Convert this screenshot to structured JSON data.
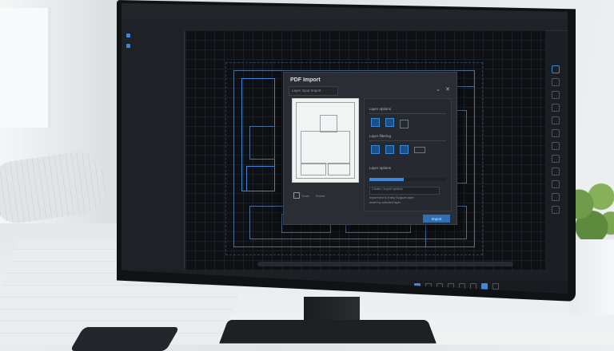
{
  "app": {
    "menu": [
      "",
      "",
      "",
      "",
      "",
      "",
      "",
      "",
      "",
      ""
    ]
  },
  "dialog": {
    "title": "PDF Import",
    "subtitle": "Layer Input Import",
    "close_glyph": "✕",
    "min_glyph": "⌄",
    "preview_footer": [
      "Scale",
      "Rotate"
    ],
    "sections": {
      "layer_options": "Layer options",
      "layer_filters": "Layer filtering",
      "layer_settings": "Layer options"
    },
    "progress": 0.45,
    "notes": [
      "Create | Import options",
      "Import text to Entry Support layer",
      "Insert by selected layer"
    ],
    "confirm_label": "Import"
  },
  "colors": {
    "accent": "#3f88d8",
    "panel": "#2a2e34",
    "canvas": "#0e1013"
  }
}
